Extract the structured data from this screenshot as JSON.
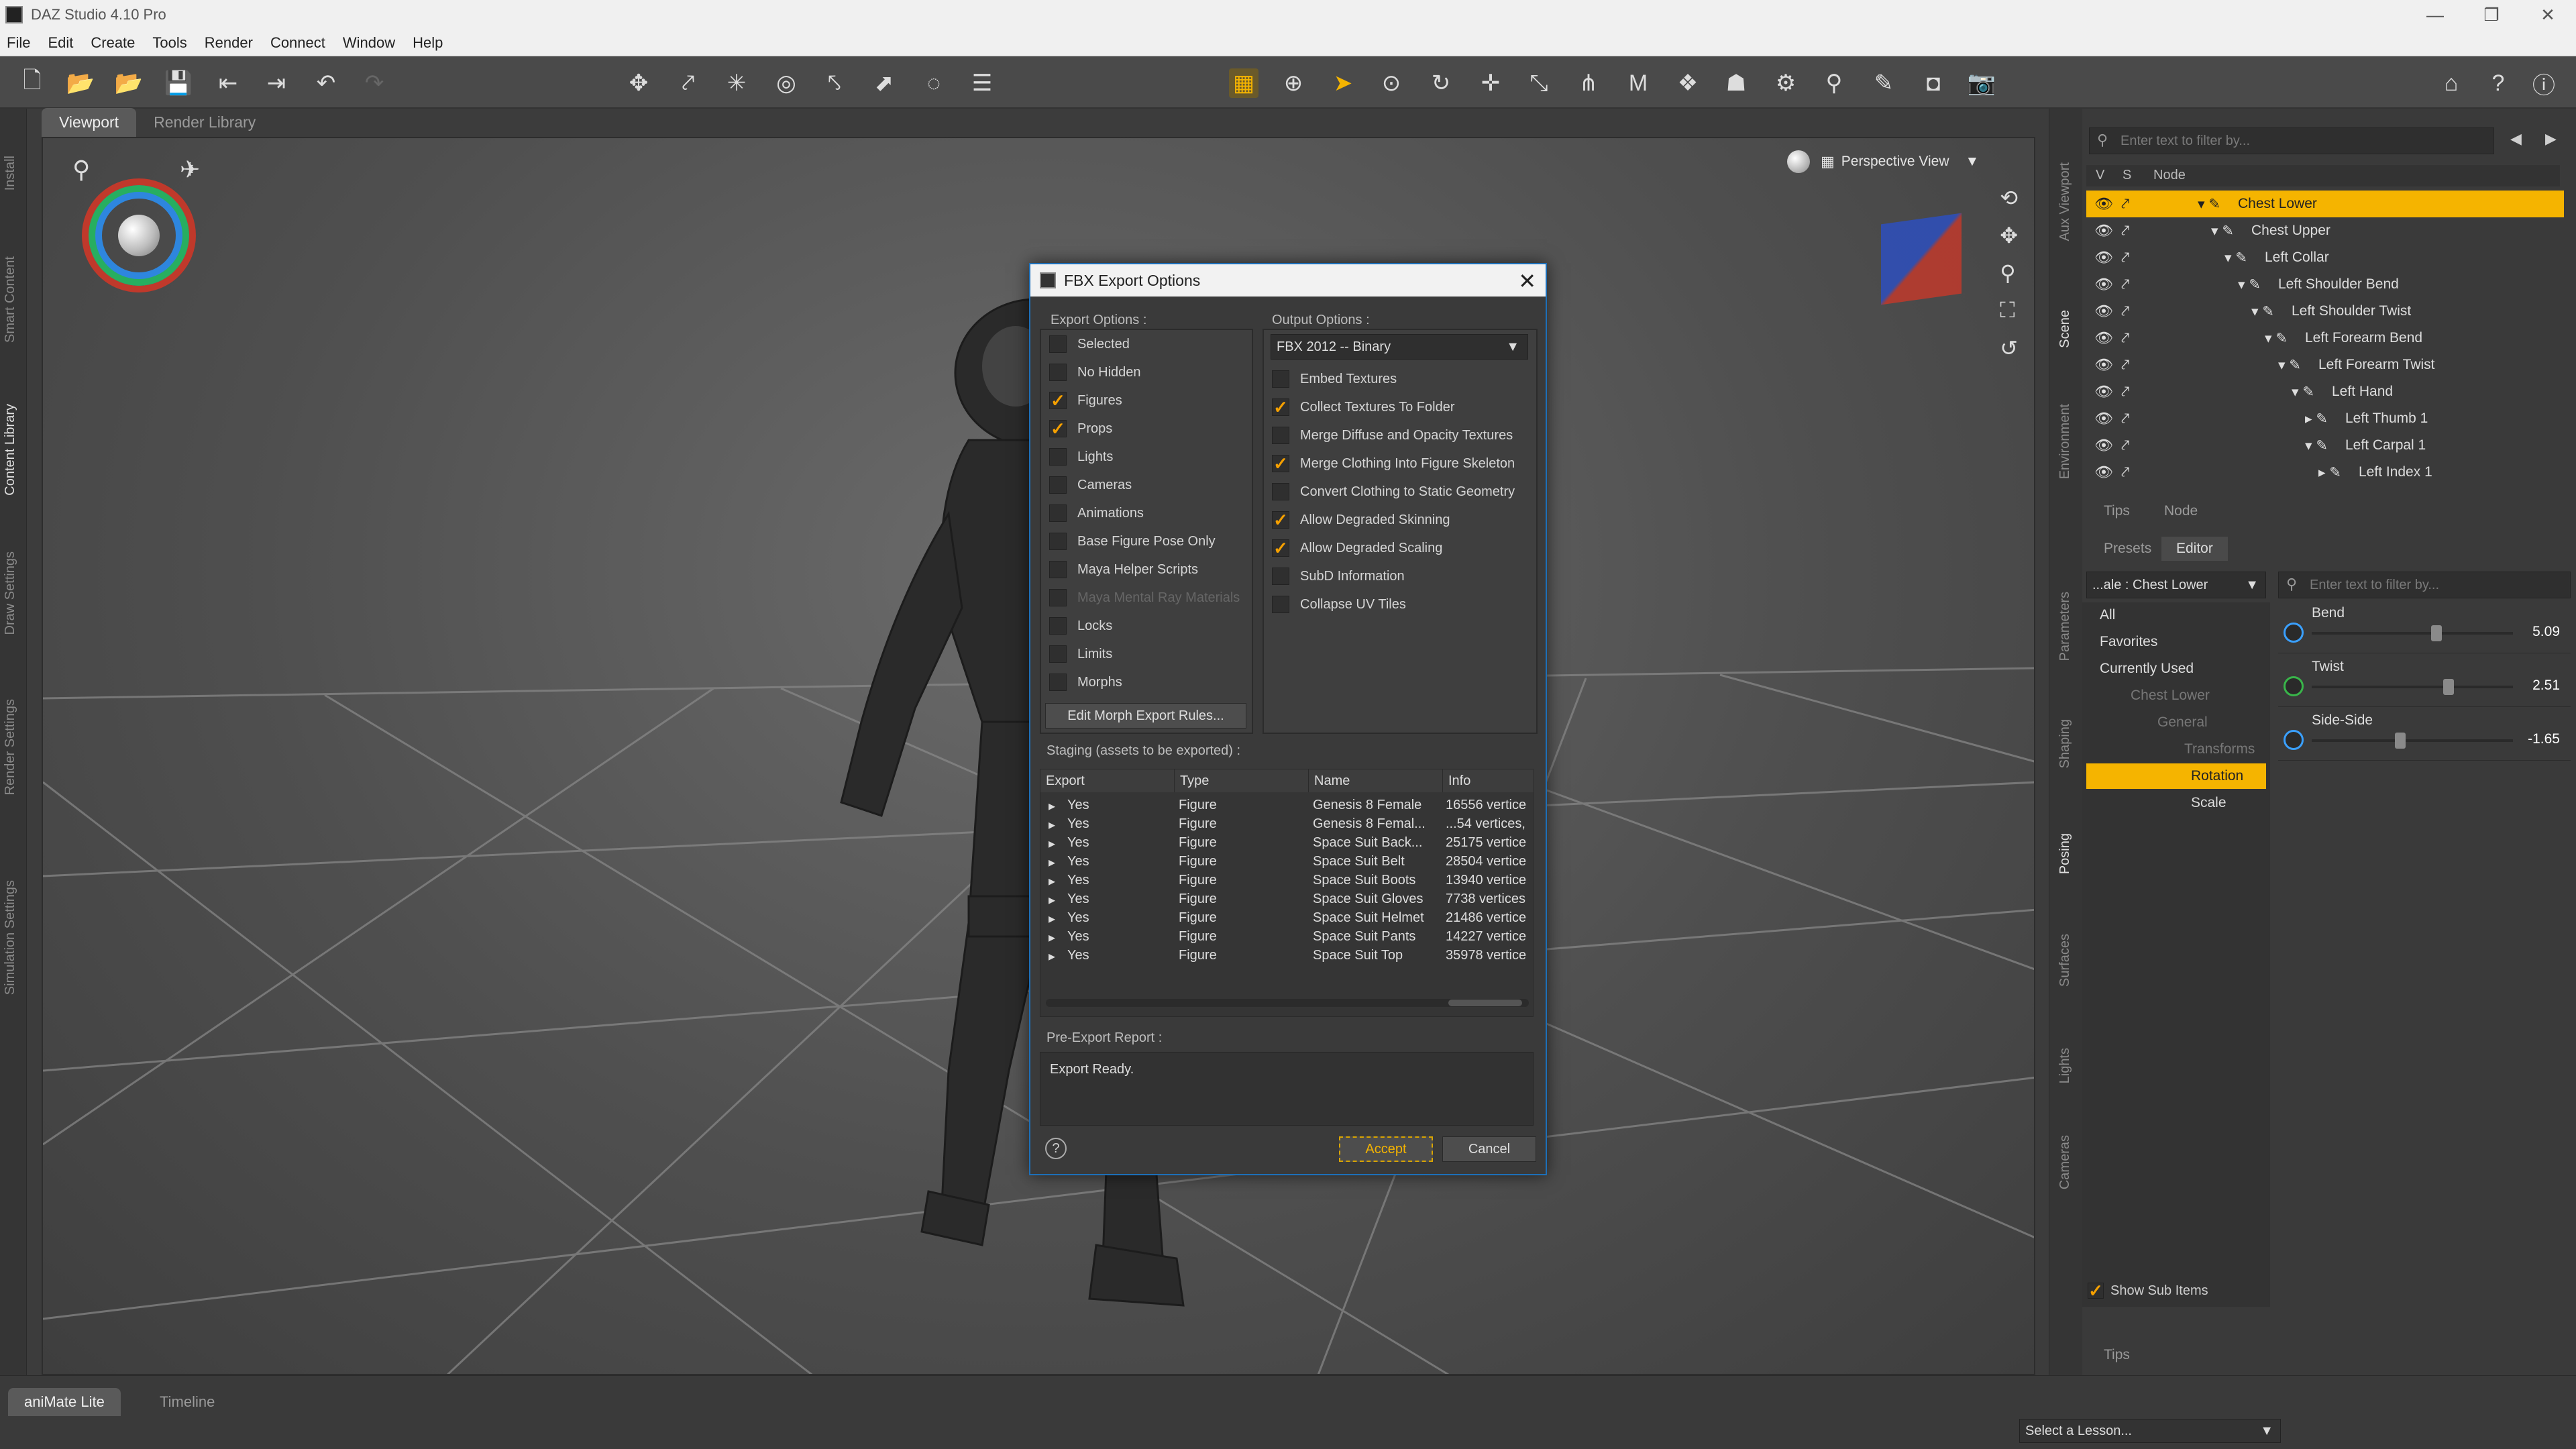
{
  "app": {
    "title": "DAZ Studio 4.10 Pro",
    "controls": [
      "—",
      "❐",
      "✕"
    ]
  },
  "menu": [
    "File",
    "Edit",
    "Create",
    "Tools",
    "Render",
    "Connect",
    "Window",
    "Help"
  ],
  "left_tabs": [
    "Install",
    "Smart Content",
    "Content Library",
    "Draw Settings",
    "Render Settings",
    "Simulation Settings"
  ],
  "viewport": {
    "tabs": [
      "Viewport",
      "Render Library"
    ],
    "view_mode": "Perspective View"
  },
  "dialog": {
    "title": "FBX Export Options",
    "export_options_label": "Export Options :",
    "output_options_label": "Output Options :",
    "export_options": [
      {
        "label": "Selected",
        "checked": false,
        "enabled": true
      },
      {
        "label": "No Hidden",
        "checked": false,
        "enabled": true
      },
      {
        "label": "Figures",
        "checked": true,
        "enabled": true
      },
      {
        "label": "Props",
        "checked": true,
        "enabled": true
      },
      {
        "label": "Lights",
        "checked": false,
        "enabled": true
      },
      {
        "label": "Cameras",
        "checked": false,
        "enabled": true
      },
      {
        "label": "Animations",
        "checked": false,
        "enabled": true
      },
      {
        "label": "Base Figure Pose Only",
        "checked": false,
        "enabled": true
      },
      {
        "label": "Maya Helper Scripts",
        "checked": false,
        "enabled": true
      },
      {
        "label": "Maya Mental Ray Materials",
        "checked": false,
        "enabled": false
      },
      {
        "label": "Locks",
        "checked": false,
        "enabled": true
      },
      {
        "label": "Limits",
        "checked": false,
        "enabled": true
      },
      {
        "label": "Morphs",
        "checked": false,
        "enabled": true
      }
    ],
    "edit_morph_button": "Edit Morph Export Rules...",
    "format_value": "FBX 2012 -- Binary",
    "output_options": [
      {
        "label": "Embed Textures",
        "checked": false
      },
      {
        "label": "Collect Textures To Folder",
        "checked": true
      },
      {
        "label": "Merge Diffuse and Opacity Textures",
        "checked": false
      },
      {
        "label": "Merge Clothing Into Figure Skeleton",
        "checked": true
      },
      {
        "label": "Convert Clothing to Static Geometry",
        "checked": false
      },
      {
        "label": "Allow Degraded Skinning",
        "checked": true
      },
      {
        "label": "Allow Degraded Scaling",
        "checked": true
      },
      {
        "label": "SubD Information",
        "checked": false
      },
      {
        "label": "Collapse UV Tiles",
        "checked": false
      }
    ],
    "staging_label": "Staging (assets to be exported) :",
    "columns": [
      "Export",
      "Type",
      "Name",
      "Info"
    ],
    "rows": [
      [
        "Yes",
        "Figure",
        "Genesis 8 Female",
        "16556 vertice"
      ],
      [
        "Yes",
        "Figure",
        "Genesis 8 Femal...",
        "...54 vertices,"
      ],
      [
        "Yes",
        "Figure",
        "Space Suit Back...",
        "25175 vertice"
      ],
      [
        "Yes",
        "Figure",
        "Space Suit Belt",
        "28504 vertice"
      ],
      [
        "Yes",
        "Figure",
        "Space Suit Boots",
        "13940 vertice"
      ],
      [
        "Yes",
        "Figure",
        "Space Suit Gloves",
        "7738 vertices"
      ],
      [
        "Yes",
        "Figure",
        "Space Suit Helmet",
        "21486 vertice"
      ],
      [
        "Yes",
        "Figure",
        "Space Suit Pants",
        "14227 vertice"
      ],
      [
        "Yes",
        "Figure",
        "Space Suit Top",
        "35978 vertice"
      ]
    ],
    "report_label": "Pre-Export Report :",
    "report_text": "Export Ready.",
    "accept": "Accept",
    "cancel": "Cancel"
  },
  "scene": {
    "filter_placeholder": "Enter text to filter by...",
    "header": {
      "v": "V",
      "s": "S",
      "node": "Node"
    },
    "nodes": [
      "Chest Lower",
      "Chest Upper",
      "Left Collar",
      "Left Shoulder Bend",
      "Left Shoulder Twist",
      "Left Forearm Bend",
      "Left Forearm Twist",
      "Left Hand",
      "Left Thumb 1",
      "Left Carpal 1",
      "Left Index 1"
    ],
    "subtabs": [
      "Tips",
      "Node"
    ]
  },
  "right_tabs": [
    "Aux Viewport",
    "Scene",
    "Environment",
    "Parameters",
    "Shaping",
    "Posing",
    "Surfaces",
    "Lights",
    "Cameras"
  ],
  "params": {
    "tabs": [
      "Presets",
      "Editor"
    ],
    "node_select": "...ale : Chest Lower",
    "filter_placeholder": "Enter text to filter by...",
    "categories": [
      "All",
      "Favorites",
      "Currently Used",
      "Chest Lower",
      "General",
      "Transforms",
      "Rotation",
      "Scale"
    ],
    "sliders": [
      {
        "label": "Bend",
        "value": "5.09",
        "pos": 0.62
      },
      {
        "label": "Twist",
        "value": "2.51",
        "pos": 0.68
      },
      {
        "label": "Side-Side",
        "value": "-1.65",
        "pos": 0.44
      }
    ],
    "show_sub_items": "Show Sub Items",
    "tips": "Tips"
  },
  "bottom": {
    "tabs": [
      "aniMate Lite",
      "Timeline"
    ],
    "lesson": "Select a Lesson..."
  },
  "colors": {
    "accent": "#f5b400",
    "dialog_border": "#1d6fb8"
  }
}
